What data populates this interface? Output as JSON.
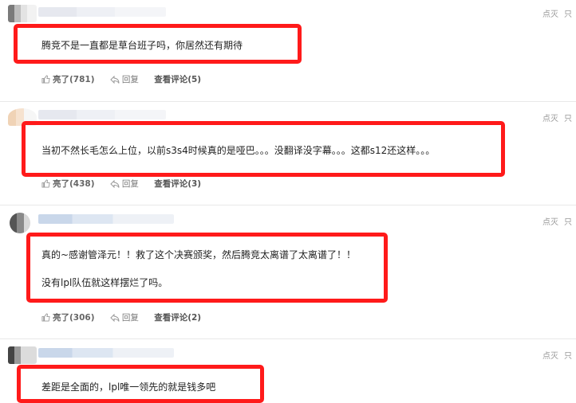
{
  "top_actions": {
    "downvote": "点灭",
    "report": "只"
  },
  "comments": [
    {
      "text": "腾竞不是一直都是草台班子吗，你居然还有期待",
      "like_label": "亮了(781)",
      "reply_label": "回复",
      "view_label": "查看评论(5)"
    },
    {
      "text": "当初不然长毛怎么上位，以前s3s4时候真的是哑巴。。。没翻译没字幕。。。这都s12还这样。。。",
      "like_label": "亮了(438)",
      "reply_label": "回复",
      "view_label": "查看评论(3)"
    },
    {
      "line1": "真的~感谢管泽元！！救了这个决赛颁奖，然后腾竞太离谱了太离谱了！！",
      "line2": "没有lpl队伍就这样摆烂了吗。",
      "like_label": "亮了(306)",
      "reply_label": "回复",
      "view_label": "查看评论(2)"
    },
    {
      "text": "差距是全面的，lpl唯一领先的就是钱多吧"
    }
  ],
  "highlight_color": "#ff1a1a"
}
